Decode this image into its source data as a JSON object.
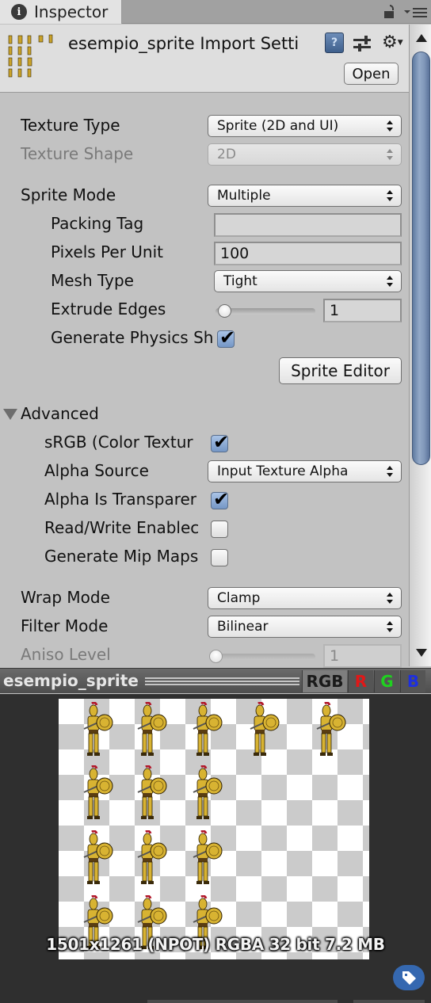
{
  "tab": {
    "label": "Inspector",
    "icon": "info-icon"
  },
  "header": {
    "title": "esempio_sprite Import Setti",
    "open_label": "Open",
    "help_icon_glyph": "?"
  },
  "fields": {
    "texture_type": {
      "label": "Texture Type",
      "value": "Sprite (2D and UI)"
    },
    "texture_shape": {
      "label": "Texture Shape",
      "value": "2D"
    },
    "sprite_mode": {
      "label": "Sprite Mode",
      "value": "Multiple"
    },
    "packing_tag": {
      "label": "Packing Tag",
      "value": ""
    },
    "pixels_per_unit": {
      "label": "Pixels Per Unit",
      "value": "100"
    },
    "mesh_type": {
      "label": "Mesh Type",
      "value": "Tight"
    },
    "extrude_edges": {
      "label": "Extrude Edges",
      "value": "1",
      "slider_fraction": 0.03
    },
    "generate_physics_shape": {
      "label": "Generate Physics Sh",
      "checked": true
    },
    "sprite_editor_label": "Sprite Editor"
  },
  "advanced": {
    "label": "Advanced",
    "srgb": {
      "label": "sRGB (Color Textur",
      "checked": true
    },
    "alpha_source": {
      "label": "Alpha Source",
      "value": "Input Texture Alpha"
    },
    "alpha_is_transparency": {
      "label": "Alpha Is Transparer",
      "checked": true
    },
    "read_write": {
      "label": "Read/Write Enablec",
      "checked": false
    },
    "generate_mip_maps": {
      "label": "Generate Mip Maps",
      "checked": false
    }
  },
  "wrap_mode": {
    "label": "Wrap Mode",
    "value": "Clamp"
  },
  "filter_mode": {
    "label": "Filter Mode",
    "value": "Bilinear"
  },
  "aniso_level": {
    "label": "Aniso Level",
    "value": "1",
    "slider_fraction": 0.0
  },
  "preview": {
    "title": "esempio_sprite",
    "channels": [
      {
        "label": "RGB",
        "color": "#1a1a1a",
        "active": true
      },
      {
        "label": "R",
        "color": "#e01818",
        "active": false
      },
      {
        "label": "G",
        "color": "#1fd11f",
        "active": false
      },
      {
        "label": "B",
        "color": "#1d2fe0",
        "active": false
      }
    ],
    "info": "1501x1261 (NPOT)  RGBA 32 bit   7.2 MB",
    "sprite_rows": [
      5,
      3,
      3,
      3
    ]
  },
  "colors": {
    "accent_blue": "#3568b0",
    "scrollbar": "#7f96b8",
    "sprite_gold": "#d8b332",
    "helmet_red": "#b2182b"
  }
}
